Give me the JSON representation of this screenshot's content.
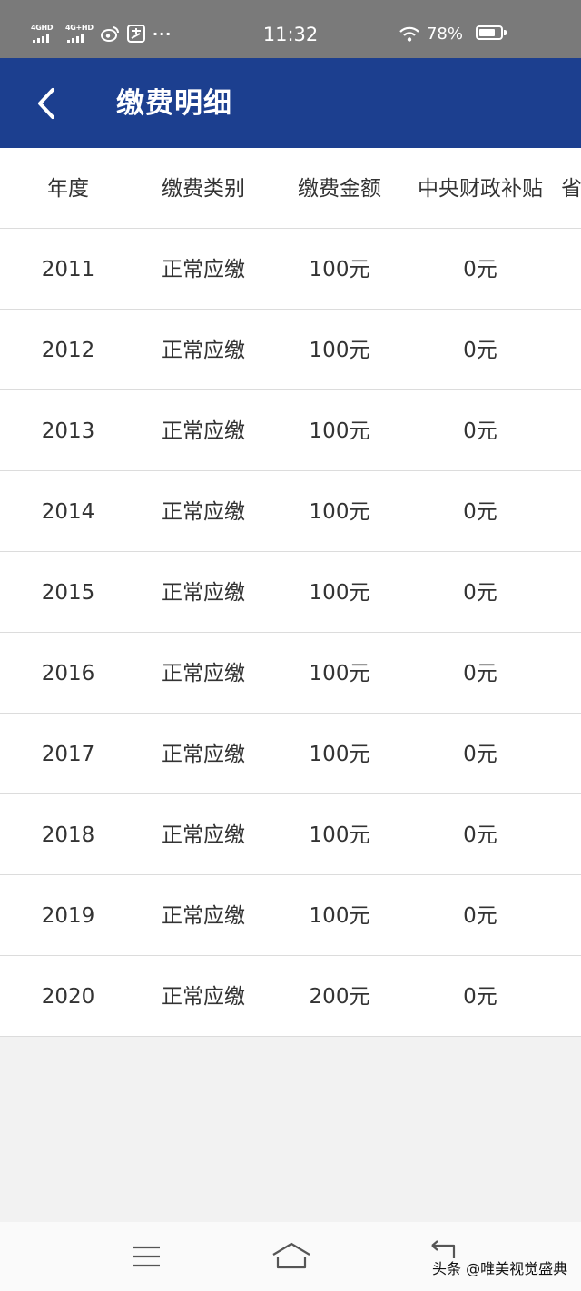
{
  "status_bar": {
    "signal1": "4GHD",
    "signal2": "4G+HD",
    "app1": "weibo-icon",
    "app2": "pay-icon",
    "more": "···",
    "time": "11:32",
    "wifi": "wifi-icon",
    "battery_pct": "78%",
    "battery_level": 0.78
  },
  "header": {
    "title": "缴费明细",
    "bg_color": "#1c3f8f"
  },
  "table": {
    "columns": [
      "年度",
      "缴费类别",
      "缴费金额",
      "中央财政补贴",
      "省"
    ],
    "rows": [
      {
        "year": "2011",
        "type": "正常应缴",
        "amount": "100元",
        "subsidy": "0元"
      },
      {
        "year": "2012",
        "type": "正常应缴",
        "amount": "100元",
        "subsidy": "0元"
      },
      {
        "year": "2013",
        "type": "正常应缴",
        "amount": "100元",
        "subsidy": "0元"
      },
      {
        "year": "2014",
        "type": "正常应缴",
        "amount": "100元",
        "subsidy": "0元"
      },
      {
        "year": "2015",
        "type": "正常应缴",
        "amount": "100元",
        "subsidy": "0元"
      },
      {
        "year": "2016",
        "type": "正常应缴",
        "amount": "100元",
        "subsidy": "0元"
      },
      {
        "year": "2017",
        "type": "正常应缴",
        "amount": "100元",
        "subsidy": "0元"
      },
      {
        "year": "2018",
        "type": "正常应缴",
        "amount": "100元",
        "subsidy": "0元"
      },
      {
        "year": "2019",
        "type": "正常应缴",
        "amount": "100元",
        "subsidy": "0元"
      },
      {
        "year": "2020",
        "type": "正常应缴",
        "amount": "200元",
        "subsidy": "0元"
      }
    ]
  },
  "nav": {
    "menu": "menu-icon",
    "home": "home-icon",
    "back": "return-icon"
  },
  "watermark": "头条 @唯美视觉盛典"
}
